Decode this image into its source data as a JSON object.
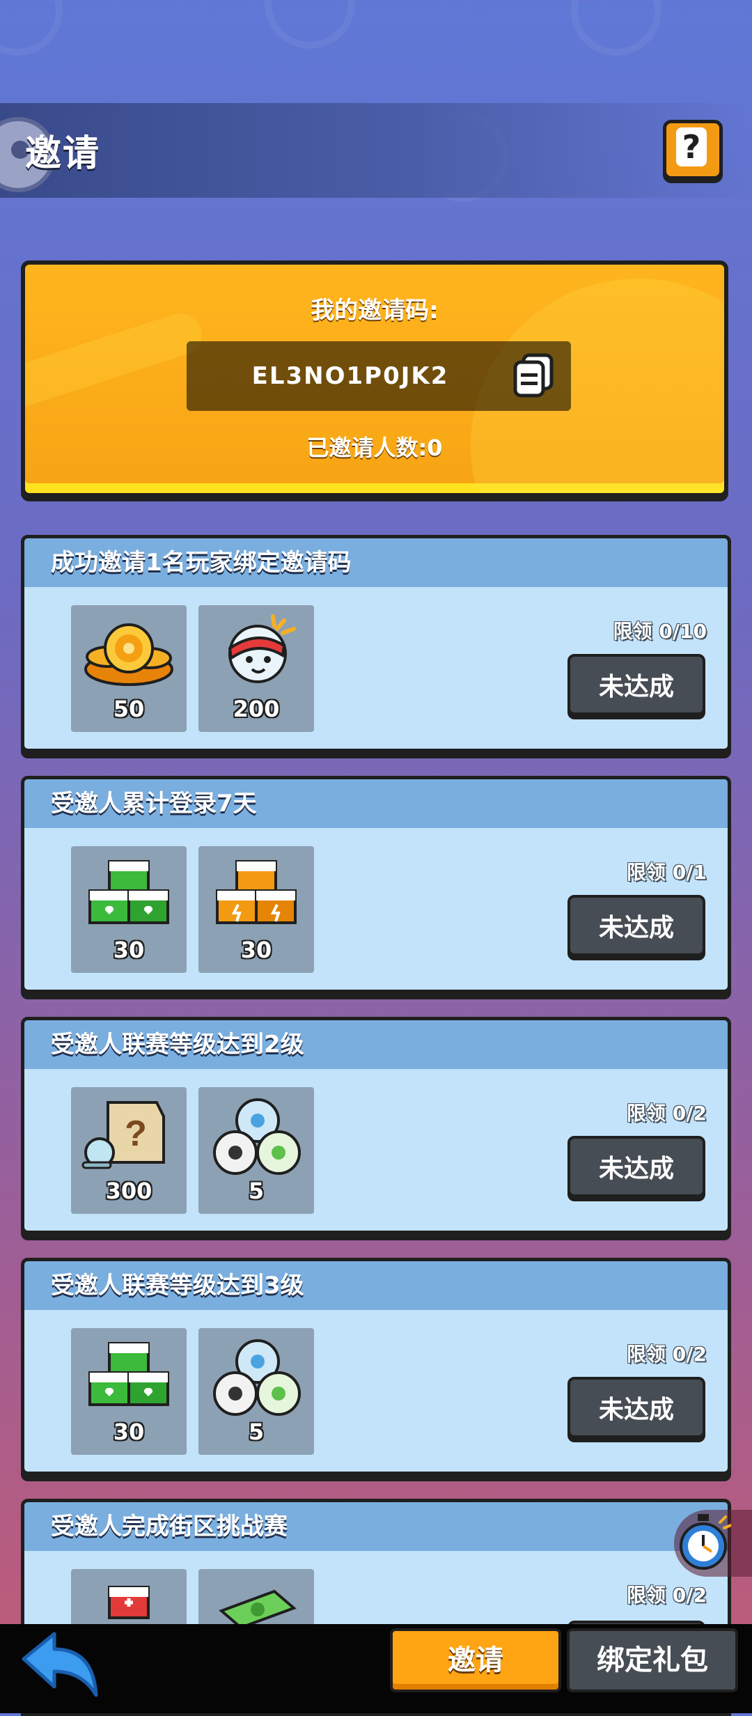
{
  "header": {
    "title": "邀请",
    "help_icon": "question-mark-icon"
  },
  "invite_code_card": {
    "label": "我的邀请码:",
    "code": "EL3NO1P0JK2",
    "invited_count_text": "已邀请人数:0",
    "accent_color": "#ffb51e"
  },
  "tasks": [
    {
      "title": "成功邀请1名玩家绑定邀请码",
      "rewards": [
        {
          "icon": "gold-coins-icon",
          "amount": "50"
        },
        {
          "icon": "headband-character-icon",
          "amount": "200"
        }
      ],
      "limit": "限领 0/10",
      "status": "未达成"
    },
    {
      "title": "受邀人累计登录7天",
      "rewards": [
        {
          "icon": "green-heart-crate-icon",
          "amount": "30"
        },
        {
          "icon": "orange-energy-crate-icon",
          "amount": "30"
        }
      ],
      "limit": "限领 0/1",
      "status": "未达成"
    },
    {
      "title": "受邀人联赛等级达到2级",
      "rewards": [
        {
          "icon": "mystery-card-pack-icon",
          "amount": "300"
        },
        {
          "icon": "soccer-balls-icon",
          "amount": "5"
        }
      ],
      "limit": "限领 0/2",
      "status": "未达成"
    },
    {
      "title": "受邀人联赛等级达到3级",
      "rewards": [
        {
          "icon": "green-heart-crate-icon",
          "amount": "30"
        },
        {
          "icon": "soccer-balls-icon",
          "amount": "5"
        }
      ],
      "limit": "限领 0/2",
      "status": "未达成"
    },
    {
      "title": "受邀人完成街区挑战赛",
      "rewards": [
        {
          "icon": "red-medkit-crate-icon",
          "amount": ""
        },
        {
          "icon": "cash-stack-icon",
          "amount": ""
        }
      ],
      "limit": "限领 0/2",
      "status": ""
    }
  ],
  "float": {
    "icon": "stopwatch-icon"
  },
  "bottom_bar": {
    "back_icon": "back-arrow-icon",
    "invite_label": "邀请",
    "gift_label": "绑定礼包"
  }
}
